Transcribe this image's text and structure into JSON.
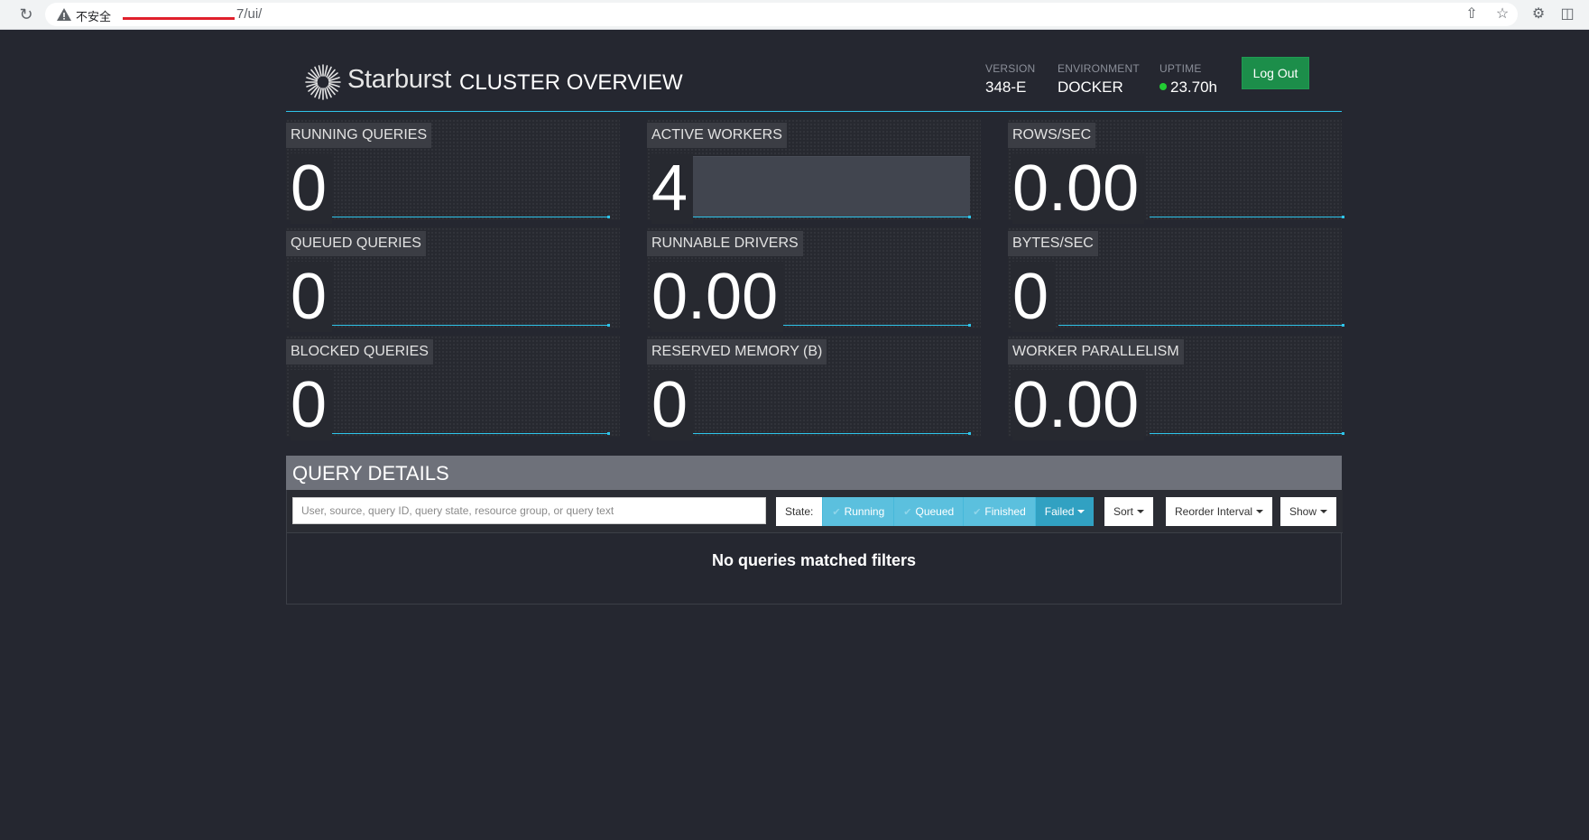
{
  "browser": {
    "security_label": "不安全",
    "url_path": "7/ui/"
  },
  "header": {
    "logo_text": "Starburst",
    "title": "CLUSTER OVERVIEW",
    "version_label": "VERSION",
    "version": "348-E",
    "environment_label": "ENVIRONMENT",
    "environment": "DOCKER",
    "uptime_label": "UPTIME",
    "uptime": "23.70h",
    "logout_label": "Log Out"
  },
  "metrics": [
    {
      "label": "RUNNING QUERIES",
      "value": "0"
    },
    {
      "label": "ACTIVE WORKERS",
      "value": "4"
    },
    {
      "label": "ROWS/SEC",
      "value": "0.00"
    },
    {
      "label": "QUEUED QUERIES",
      "value": "0"
    },
    {
      "label": "RUNNABLE DRIVERS",
      "value": "0.00"
    },
    {
      "label": "BYTES/SEC",
      "value": "0"
    },
    {
      "label": "BLOCKED QUERIES",
      "value": "0"
    },
    {
      "label": "RESERVED MEMORY (B)",
      "value": "0"
    },
    {
      "label": "WORKER PARALLELISM",
      "value": "0.00"
    }
  ],
  "query_details": {
    "title": "QUERY DETAILS",
    "search_placeholder": "User, source, query ID, query state, resource group, or query text",
    "state_label": "State:",
    "states": {
      "running": "Running",
      "queued": "Queued",
      "finished": "Finished",
      "failed": "Failed"
    },
    "sort_label": "Sort",
    "reorder_label": "Reorder Interval",
    "show_label": "Show",
    "empty_message": "No queries matched filters"
  },
  "colors": {
    "background": "#252730",
    "accent": "#2ec4ea",
    "logout": "#1c8e4a",
    "state_button": "#5bc0de"
  }
}
